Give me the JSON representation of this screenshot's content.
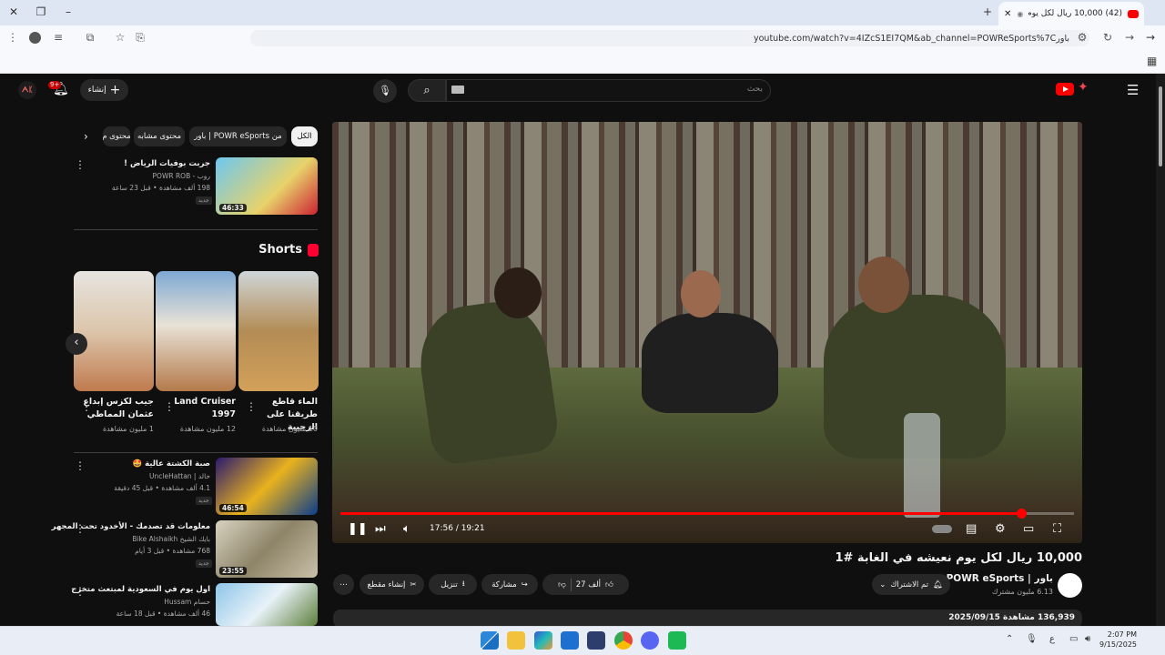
{
  "browser": {
    "tab_title": "(42) 10,000 ريال لكل يوم نعي",
    "url": "youtube.com/watch?v=4IZcS1EI7QM&ab_channel=POWReSports%7Cباور"
  },
  "header": {
    "search_placeholder": "بحث",
    "create_label": "إنشاء",
    "notif_badge": "9+",
    "avatar_text": "ᗅᛕ"
  },
  "chips": [
    "الكل",
    "من POWR eSports | باور",
    "محتوى مشابه",
    "محتوى م"
  ],
  "top_video": {
    "title": "جربت بوفيات الرياض !",
    "channel": "روب - POWR ROB",
    "meta": "198 ألف مشاهدة • قبل 23 ساعة",
    "badge": "جديد",
    "duration": "46:33"
  },
  "shorts": {
    "title": "Shorts",
    "items": [
      {
        "title": "الماء قاطع طريقنا على الرحبية",
        "views": "10 مليون مشاهدة"
      },
      {
        "title": "Land Cruiser 1997",
        "views": "12 مليون مشاهدة"
      },
      {
        "title": "جيب لكزس إبداع عثمان المماطي",
        "views": "1 مليون مشاهدة"
      }
    ]
  },
  "list": [
    {
      "title": "صبة الكشتة عالية 🤩",
      "channel": "خالد | UncleHattan",
      "meta": "4.1 ألف مشاهدة • قبل 45 دقيقة",
      "badge": "جديد",
      "duration": "46:54"
    },
    {
      "title": "معلومات قد تصدمك - الأخدود تحت المجهر",
      "channel": "بايك الشيخ Bike Alshaikh",
      "meta": "768 مشاهدة • قبل 3 أيام",
      "badge": "جديد",
      "duration": "23:55"
    },
    {
      "title": "اول يوم في السعودية لمبتعث متخرج",
      "channel": "حسام Hussam",
      "meta": "46 ألف مشاهدة • قبل 18 ساعة",
      "badge": "جديد",
      "duration": ""
    }
  ],
  "player": {
    "time": "17:56 / 19:21",
    "progress": 0.928
  },
  "video": {
    "title": "10,000 ريال لكل يوم نعيشه في الغابة #1",
    "channel": "باور | POWR eSports",
    "subs": "6.13 مليون مشترك",
    "subscribed": "تم الاشتراك",
    "likes": "27 ألف",
    "share": "مشاركة",
    "download": "تنزيل",
    "clip": "إنشاء مقطع",
    "views_date": "136,939 مشاهدة  2025/09/15"
  },
  "taskbar": {
    "time": "2:07 PM",
    "date": "9/15/2025",
    "lang": "ع"
  },
  "colors": {
    "accent": "#ff0000",
    "bg": "#0f0f0f"
  }
}
